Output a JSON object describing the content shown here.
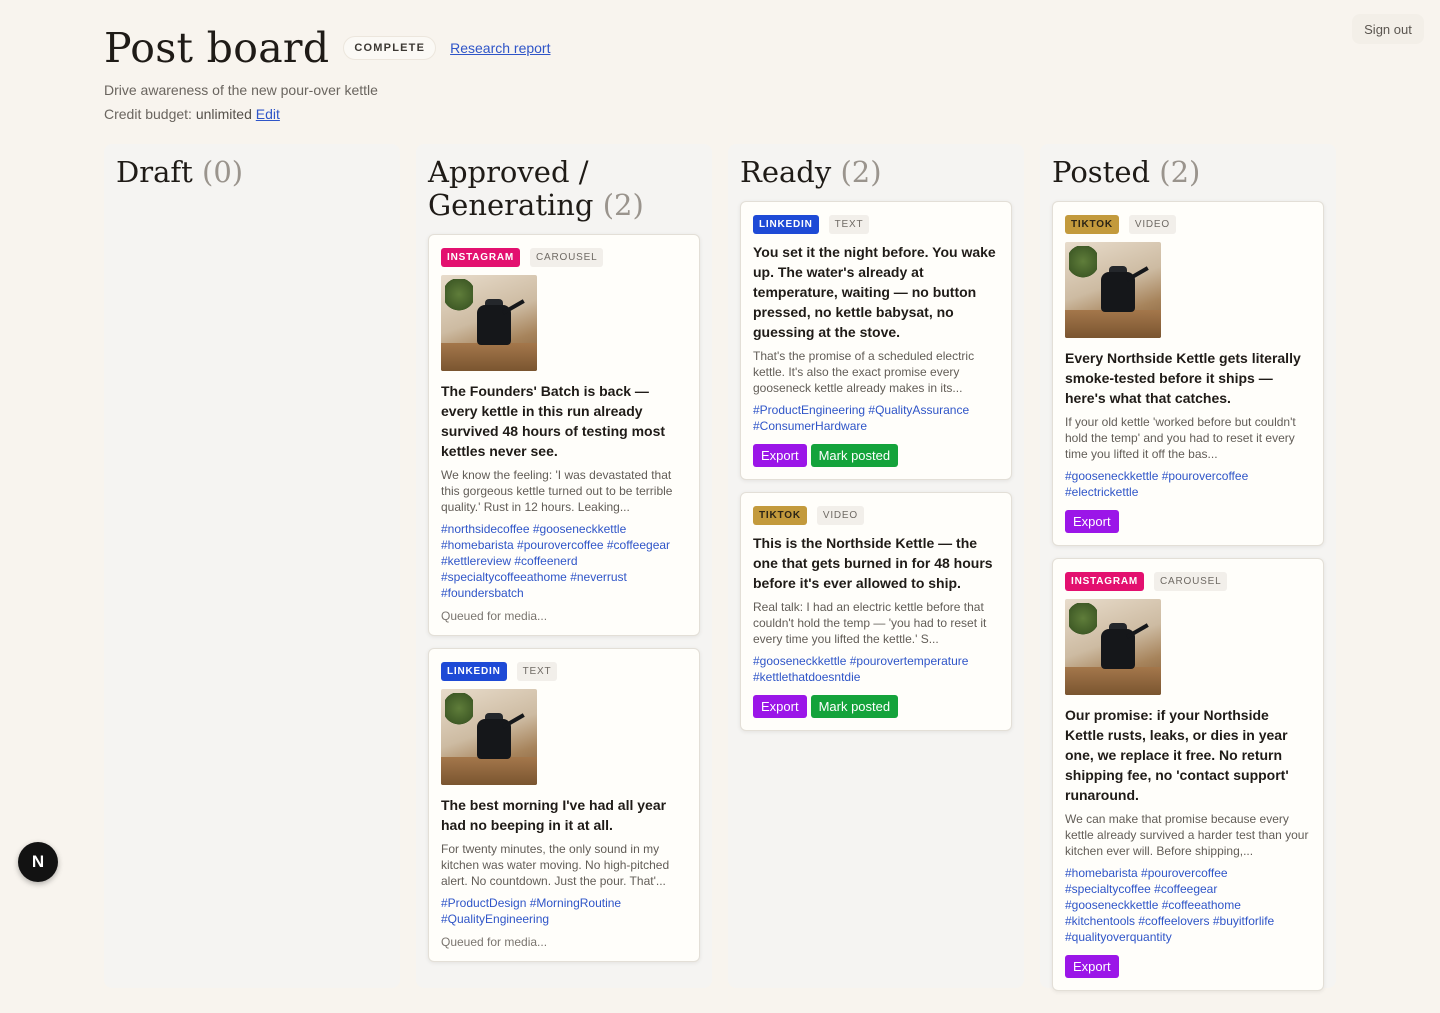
{
  "auth": {
    "signout_label": "Sign out"
  },
  "header": {
    "title": "Post board",
    "status": "COMPLETE",
    "report_link": "Research report",
    "subtitle": "Drive awareness of the new pour-over kettle",
    "budget_label": "Credit budget:",
    "budget_value": "unlimited",
    "budget_edit": "Edit"
  },
  "columns": [
    {
      "title": "Draft",
      "count": "(0)"
    },
    {
      "title": "Approved / Generating",
      "count": "(2)"
    },
    {
      "title": "Ready",
      "count": "(2)"
    },
    {
      "title": "Posted",
      "count": "(2)"
    }
  ],
  "cards": {
    "approved_1": {
      "platform": "INSTAGRAM",
      "format": "CAROUSEL",
      "headline": "The Founders' Batch is back — every kettle in this run already survived 48 hours of testing most kettles never see.",
      "body": "We know the feeling: 'I was devastated that this gorgeous kettle turned out to be terrible quality.' Rust in 12 hours. Leaking...",
      "hashtags": "#northsidecoffee #gooseneckkettle #homebarista #pourovercoffee #coffeegear #kettlereview #coffeenerd #specialtycoffeeathome #neverrust #foundersbatch",
      "status": "Queued for media..."
    },
    "approved_2": {
      "platform": "LINKEDIN",
      "format": "TEXT",
      "headline": "The best morning I've had all year had no beeping in it at all.",
      "body": "For twenty minutes, the only sound in my kitchen was water moving. No high-pitched alert. No countdown. Just the pour. That'...",
      "hashtags": "#ProductDesign #MorningRoutine #QualityEngineering",
      "status": "Queued for media..."
    },
    "ready_1": {
      "platform": "LINKEDIN",
      "format": "TEXT",
      "headline": "You set it the night before. You wake up. The water's already at temperature, waiting — no button pressed, no kettle babysat, no guessing at the stove.",
      "body": "That's the promise of a scheduled electric kettle. It's also the exact promise every gooseneck kettle already makes in its...",
      "hashtags": "#ProductEngineering #QualityAssurance #ConsumerHardware",
      "export": "Export",
      "mark_posted": "Mark posted"
    },
    "ready_2": {
      "platform": "TIKTOK",
      "format": "VIDEO",
      "headline": "This is the Northside Kettle — the one that gets burned in for 48 hours before it's ever allowed to ship.",
      "body": "Real talk: I had an electric kettle before that couldn't hold the temp — 'you had to reset it every time you lifted the kettle.' S...",
      "hashtags": "#gooseneckkettle #pourovertemperature #kettlethatdoesntdie",
      "export": "Export",
      "mark_posted": "Mark posted"
    },
    "posted_1": {
      "platform": "TIKTOK",
      "format": "VIDEO",
      "headline": "Every Northside Kettle gets literally smoke-tested before it ships — here's what that catches.",
      "body": "If your old kettle 'worked before but couldn't hold the temp' and you had to reset it every time you lifted it off the bas...",
      "hashtags": "#gooseneckkettle #pourovercoffee #electrickettle",
      "export": "Export"
    },
    "posted_2": {
      "platform": "INSTAGRAM",
      "format": "CAROUSEL",
      "headline": "Our promise: if your Northside Kettle rusts, leaks, or dies in year one, we replace it free. No return shipping fee, no 'contact support' runaround.",
      "body": "We can make that promise because every kettle already survived a harder test than your kitchen ever will. Before shipping,...",
      "hashtags": "#homebarista #pourovercoffee #specialtycoffee #coffeegear #gooseneckkettle #coffeeathome #kitchentools #coffeelovers #buyitforlife #qualityoverquantity",
      "export": "Export"
    }
  },
  "dev_badge": "N",
  "colors": {
    "export": "#9b16e8",
    "mark_posted": "#14a33b",
    "instagram": "#e3106f",
    "linkedin": "#1e4ad6",
    "tiktok": "#c39a3c",
    "link": "#2f55c8"
  }
}
